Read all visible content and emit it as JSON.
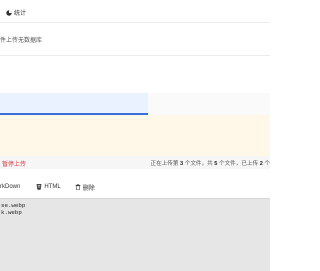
{
  "header": {
    "stats_label": "统计"
  },
  "upload": {
    "empty_message": "件上传无数据库"
  },
  "status": {
    "left_text": "暂停上传",
    "right_prefix": "正在上传第",
    "current": "3",
    "mid1": "个文件，共",
    "total": "5",
    "mid2": "个文件，已上传",
    "done": "2",
    "suffix": "个"
  },
  "tabs": [
    {
      "label": "rkDown",
      "icon": "markdown-icon"
    },
    {
      "label": "HTML",
      "icon": "html-icon"
    },
    {
      "label": "删除",
      "icon": "trash-icon"
    }
  ],
  "output": {
    "lines": [
      "se.webp",
      "k.webp"
    ]
  },
  "colors": {
    "accent": "#3b6ed6",
    "warning_bg": "#fff7e8",
    "danger": "#d9363e"
  }
}
